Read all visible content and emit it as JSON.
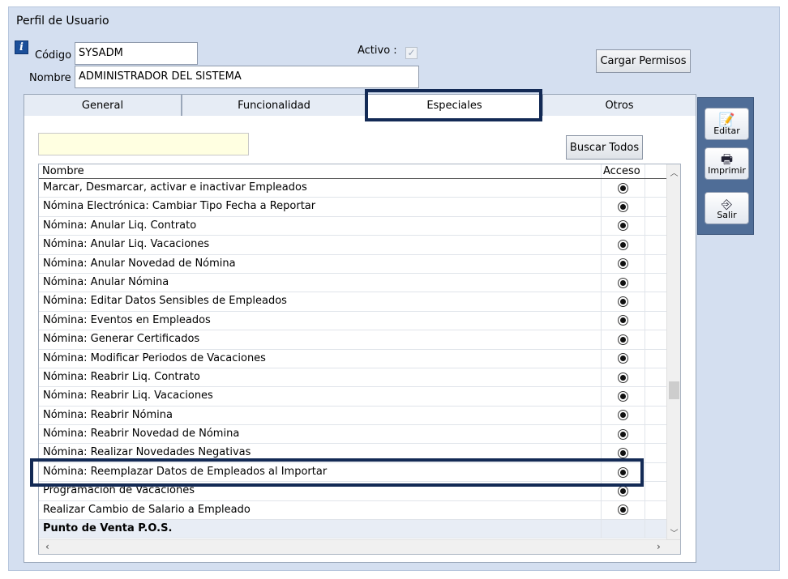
{
  "window": {
    "title": "Perfil de Usuario"
  },
  "form": {
    "codigo_label": "Código",
    "codigo_value": "SYSADM",
    "nombre_label": "Nombre",
    "nombre_value": "ADMINISTRADOR DEL SISTEMA",
    "activo_label": "Activo :",
    "activo_checked": true,
    "cargar_button": "Cargar Permisos"
  },
  "tabs": [
    {
      "label": "General",
      "active": false
    },
    {
      "label": "Funcionalidad",
      "active": false
    },
    {
      "label": "Especiales",
      "active": true
    },
    {
      "label": "Otros",
      "active": false
    }
  ],
  "panel": {
    "search_value": "",
    "buscar_button": "Buscar Todos",
    "columns": {
      "nombre": "Nombre",
      "acceso": "Acceso"
    },
    "rows": [
      {
        "name": "Marcar, Desmarcar, activar e inactivar Empleados",
        "acceso": true
      },
      {
        "name": "Nómina Electrónica: Cambiar Tipo Fecha a Reportar",
        "acceso": true
      },
      {
        "name": "Nómina: Anular  Liq. Contrato",
        "acceso": true
      },
      {
        "name": "Nómina: Anular  Liq. Vacaciones",
        "acceso": true
      },
      {
        "name": "Nómina: Anular  Novedad de Nómina",
        "acceso": true
      },
      {
        "name": "Nómina: Anular Nómina",
        "acceso": true
      },
      {
        "name": "Nómina: Editar Datos Sensibles de Empleados",
        "acceso": true
      },
      {
        "name": "Nómina: Eventos en Empleados",
        "acceso": true
      },
      {
        "name": "Nómina: Generar Certificados",
        "acceso": true
      },
      {
        "name": "Nómina: Modificar Periodos de Vacaciones",
        "acceso": true
      },
      {
        "name": "Nómina: Reabrir Liq. Contrato",
        "acceso": true
      },
      {
        "name": "Nómina: Reabrir Liq. Vacaciones",
        "acceso": true
      },
      {
        "name": "Nómina: Reabrir Nómina",
        "acceso": true
      },
      {
        "name": "Nómina: Reabrir Novedad de Nómina",
        "acceso": true
      },
      {
        "name": "Nómina: Realizar Novedades Negativas",
        "acceso": true
      },
      {
        "name": "Nómina: Reemplazar Datos de Empleados al Importar",
        "acceso": true
      },
      {
        "name": "Programación de Vacaciones",
        "acceso": true
      },
      {
        "name": "Realizar Cambio de Salario a Empleado",
        "acceso": true
      },
      {
        "name": "Punto de Venta P.O.S.",
        "acceso": false,
        "group": true
      }
    ]
  },
  "toolbar": {
    "editar": "Editar",
    "imprimir": "Imprimir",
    "salir": "Salir"
  },
  "icons": {
    "info": "info-icon",
    "edit": "edit-icon",
    "print": "printer-icon",
    "exit": "exit-door-icon"
  },
  "colors": {
    "highlight": "#132a55",
    "window_bg": "#d4dff0",
    "toolbar_bg": "#4f6d97"
  }
}
